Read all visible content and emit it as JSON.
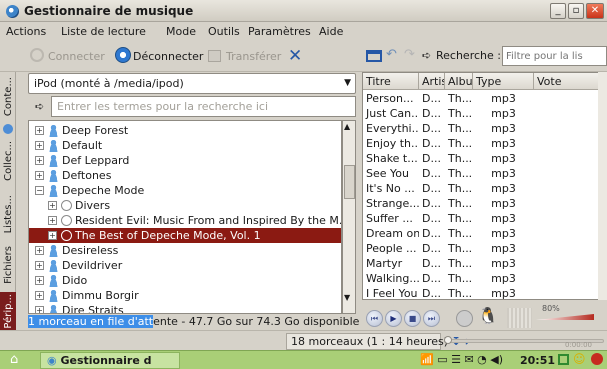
{
  "window": {
    "title": "Gestionnaire de musique"
  },
  "menubar": [
    "Actions",
    "Liste de lecture",
    "Mode",
    "Outils",
    "Paramètres",
    "Aide"
  ],
  "toolbar": {
    "connect": "Connecter",
    "disconnect": "Déconnecter",
    "transfer": "Transférer"
  },
  "sidetabs": [
    "Conte...",
    "Collec...",
    "Listes...",
    "Fichiers",
    "Périp..."
  ],
  "device": {
    "selected": "iPod (monté à /media/ipod)"
  },
  "search": {
    "placeholder": "Entrer les termes pour la recherche ici"
  },
  "tree": [
    {
      "label": "Deep Forest",
      "type": "artist",
      "level": 0,
      "expander": "+"
    },
    {
      "label": "Default",
      "type": "artist",
      "level": 0,
      "expander": "+"
    },
    {
      "label": "Def Leppard",
      "type": "artist",
      "level": 0,
      "expander": "+"
    },
    {
      "label": "Deftones",
      "type": "artist",
      "level": 0,
      "expander": "+"
    },
    {
      "label": "Depeche Mode",
      "type": "artist",
      "level": 0,
      "expander": "−"
    },
    {
      "label": "Divers",
      "type": "album",
      "level": 1,
      "expander": "+"
    },
    {
      "label": "Resident Evil: Music From and Inspired By the M...",
      "type": "album",
      "level": 1,
      "expander": "+"
    },
    {
      "label": "The Best of Depeche Mode, Vol. 1",
      "type": "album",
      "level": 1,
      "expander": "+",
      "selected": true
    },
    {
      "label": "Desireless",
      "type": "artist",
      "level": 0,
      "expander": "+"
    },
    {
      "label": "Devildriver",
      "type": "artist",
      "level": 0,
      "expander": "+"
    },
    {
      "label": "Dido",
      "type": "artist",
      "level": 0,
      "expander": "+"
    },
    {
      "label": "Dimmu Borgir",
      "type": "artist",
      "level": 0,
      "expander": "+"
    },
    {
      "label": "Dire Straits",
      "type": "artist",
      "level": 0,
      "expander": "+"
    }
  ],
  "recherche": {
    "label": "Recherche :",
    "placeholder": "Filtre pour la lis"
  },
  "table": {
    "columns": [
      "Titre",
      "Artis",
      "Albu",
      "Type",
      "Vote"
    ],
    "rows": [
      [
        "Person...",
        "D...",
        "Th...",
        "mp3",
        ""
      ],
      [
        "Just Can...",
        "D...",
        "Th...",
        "mp3",
        ""
      ],
      [
        "Everythi...",
        "D...",
        "Th...",
        "mp3",
        ""
      ],
      [
        "Enjoy th...",
        "D...",
        "Th...",
        "mp3",
        ""
      ],
      [
        "Shake t...",
        "D...",
        "Th...",
        "mp3",
        ""
      ],
      [
        "See You",
        "D...",
        "Th...",
        "mp3",
        ""
      ],
      [
        "It's No ...",
        "D...",
        "Th...",
        "mp3",
        ""
      ],
      [
        "Strange...",
        "D...",
        "Th...",
        "mp3",
        ""
      ],
      [
        "Suffer ...",
        "D...",
        "Th...",
        "mp3",
        ""
      ],
      [
        "Dream on",
        "D...",
        "Th...",
        "mp3",
        ""
      ],
      [
        "People ...",
        "D...",
        "Th...",
        "mp3",
        ""
      ],
      [
        "Martyr",
        "D...",
        "Th...",
        "mp3",
        ""
      ],
      [
        "Walking...",
        "D...",
        "Th...",
        "mp3",
        ""
      ],
      [
        "I Feel You",
        "D...",
        "Th...",
        "mp3",
        ""
      ]
    ]
  },
  "player": {
    "volume_label": "80%",
    "volume_level": 0.8,
    "time": "0:00:00"
  },
  "status": {
    "queue_highlight": "1 morceau en file d'att",
    "queue_rest": "ente - 47.7 Go sur 74.3 Go disponible",
    "track_count": "18 morceaux (1 : 14 heures)"
  },
  "taskbar": {
    "item": "Gestionnaire d",
    "clock": "20:51"
  },
  "colors": {
    "selection": "#8b1a12",
    "highlight": "#3d8ee8",
    "taskbar": "#a9cf77"
  }
}
